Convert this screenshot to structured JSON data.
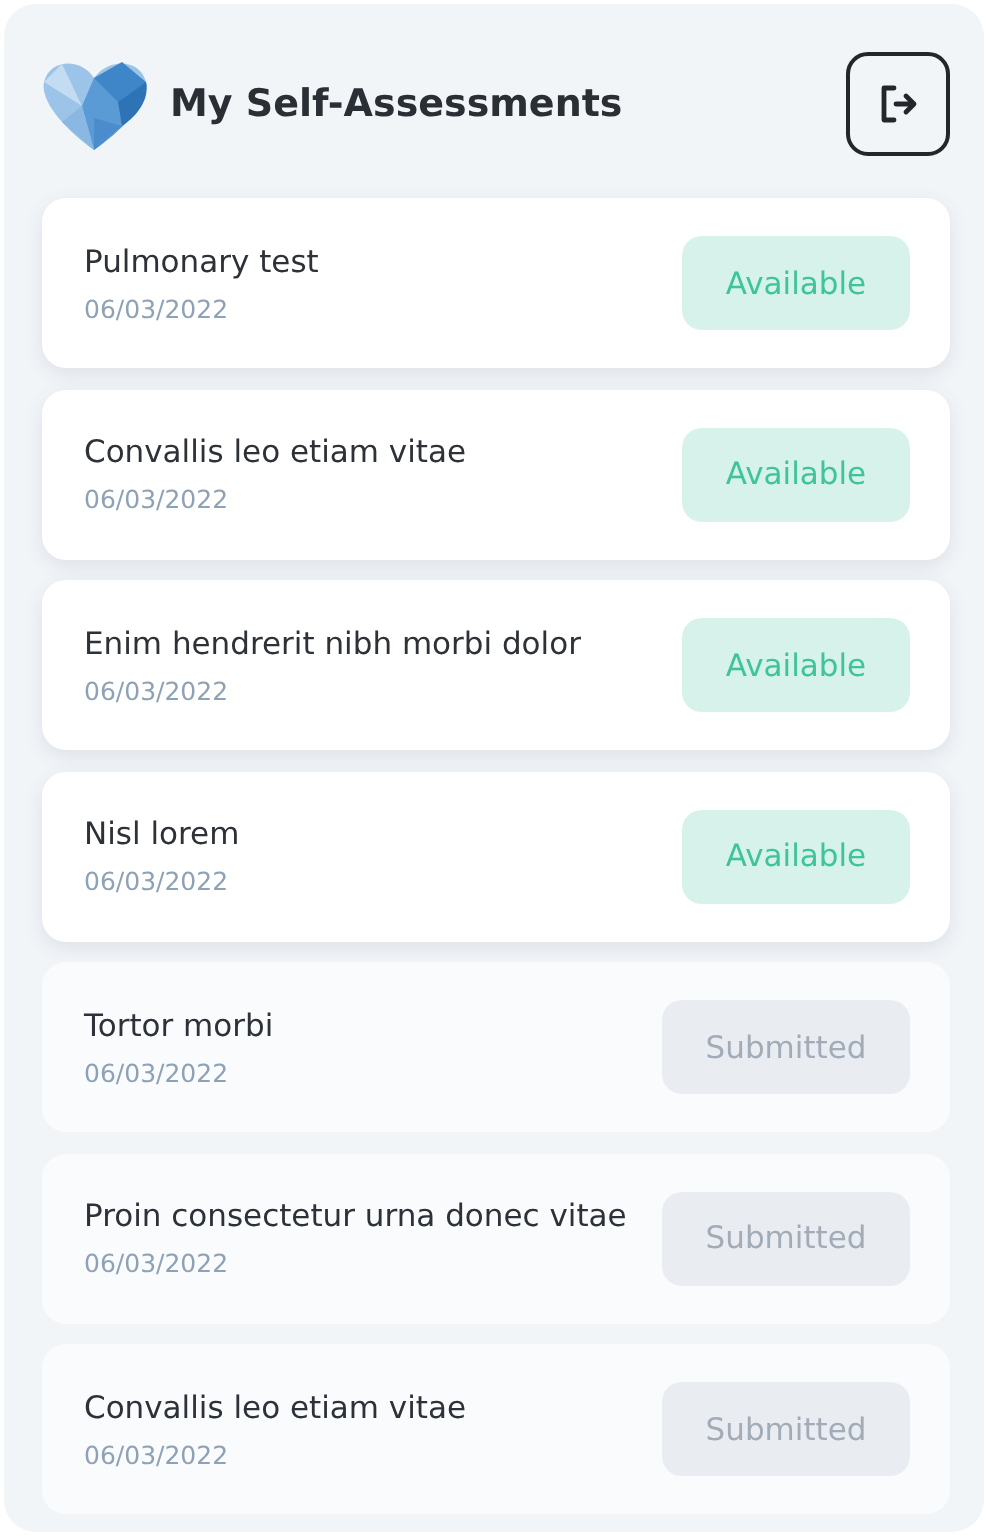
{
  "header": {
    "title": "My Self-Assessments"
  },
  "assessments": [
    {
      "name": "Pulmonary test",
      "date": "06/03/2022",
      "kind": "available",
      "status": "Available"
    },
    {
      "name": "Convallis leo etiam vitae",
      "date": "06/03/2022",
      "kind": "available",
      "status": "Available"
    },
    {
      "name": "Enim hendrerit nibh morbi dolor",
      "date": "06/03/2022",
      "kind": "available",
      "status": "Available"
    },
    {
      "name": "Nisl lorem",
      "date": "06/03/2022",
      "kind": "available",
      "status": "Available"
    },
    {
      "name": "Tortor morbi",
      "date": "06/03/2022",
      "kind": "submitted",
      "status": "Submitted"
    },
    {
      "name": "Proin consectetur urna donec vitae",
      "date": "06/03/2022",
      "kind": "submitted",
      "status": "Submitted"
    },
    {
      "name": "Convallis leo etiam vitae",
      "date": "06/03/2022",
      "kind": "submitted",
      "status": "Submitted"
    }
  ]
}
